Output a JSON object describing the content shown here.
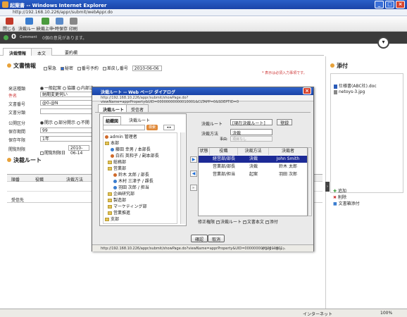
{
  "window": {
    "title": "起案書 -- Windows Internet Explorer",
    "url": "http://192.168.10.226/appr/submit/webAppr.do"
  },
  "toolbar": {
    "items": [
      "閉じる",
      "決裁ルート",
      "決裁上申",
      "一時保存",
      "印刷"
    ]
  },
  "comments": {
    "count": "0",
    "label": "Comment",
    "message": "0個の意見があります。"
  },
  "tabs": [
    "決裁情報",
    "本文",
    "要約欄"
  ],
  "doc": {
    "title": "文書情報",
    "required_note": "* 表示は必須入力事項です。",
    "kind_label": "発送種類",
    "kind_opts": [
      "一般起案",
      "協議",
      "内部決"
    ],
    "badge_opts": [
      "緊急",
      "秘密",
      "番号予約",
      "差戻し番号"
    ],
    "date_value": "2010-06-06",
    "subject_label": "件名",
    "subject_value": "納期変更伺い",
    "docno_label": "文書番号",
    "docno_value": "@0-@N",
    "category_label": "文書分類",
    "public_label": "公開区分",
    "public_opts": [
      "開示",
      "部分開示",
      "不開"
    ],
    "retention_label": "保存期間",
    "retention_value": "99",
    "period_label": "保存年限",
    "period_value": "1年",
    "close_label": "閲覧制限",
    "close_check": "閲覧制限日",
    "close_date": "2010-06-14"
  },
  "route": {
    "title": "決裁ルート",
    "headers": [
      "順番",
      "役職",
      "決裁方法",
      ""
    ],
    "receiver_label": "受信先"
  },
  "attach": {
    "title": "添付",
    "files": [
      "仕様書(ABC社).doc",
      "netoys-3.jpg"
    ],
    "actions": [
      "追加",
      "削除",
      "文書箱添付"
    ]
  },
  "statusbar": {
    "zone": "インターネット",
    "zoom": "100%"
  },
  "modal": {
    "title": "決裁ルート -- Web ページ ダイアログ",
    "url": "http://192.168.10.226/appr/submit/showPage.do?viewName=apprProperty&UID=00000000000010001&CLTAPP=0&SDEPTID=0",
    "tabs": [
      "決裁ルート",
      "受信者"
    ],
    "left_tabs": [
      "組織図",
      "決裁ルート"
    ],
    "search_btn": "検索",
    "tree": [
      {
        "text": "admin 管理者",
        "type": "person"
      },
      {
        "text": "本部",
        "type": "folder"
      },
      {
        "text": "藤田 幸男 / 本部長",
        "type": "person"
      },
      {
        "text": "白石 英和子 / 副本部長",
        "type": "person"
      },
      {
        "text": "総務部",
        "type": "folder"
      },
      {
        "text": "営業部",
        "type": "folder"
      },
      {
        "text": "鈴木 太郎 / 部長",
        "type": "person"
      },
      {
        "text": "木村 三津子 / 課長",
        "type": "person"
      },
      {
        "text": "羽田 次郎 / 担当",
        "type": "person"
      },
      {
        "text": "企画研究部",
        "type": "folder"
      },
      {
        "text": "製造部",
        "type": "folder"
      },
      {
        "text": "マーケティング部",
        "type": "folder"
      },
      {
        "text": "営業推進",
        "type": "folder"
      },
      {
        "text": "支部",
        "type": "folder"
      }
    ],
    "route_label": "決裁ルート",
    "route_value": "[現在決裁ルート]",
    "register_btn": "登録",
    "method_label": "決裁方法",
    "method_value": "決裁",
    "matter_label": "事由:",
    "matter_value": "項目なし",
    "table_headers": [
      "状態",
      "役職",
      "決裁方法",
      "決裁者"
    ],
    "rows": [
      {
        "status": "",
        "role": "経営部/部長",
        "method": "決裁",
        "name": "John Smith",
        "selected": true
      },
      {
        "status": "",
        "role": "営業部/部長",
        "method": "決裁",
        "name": "鈴木 太郎",
        "selected": false
      },
      {
        "status": "",
        "role": "営業部/担当",
        "method": "起案",
        "name": "羽田 次郎",
        "selected": false
      }
    ],
    "perm_label": "修正権限",
    "perm_checks": [
      "決裁ルート",
      "文書本文",
      "添付"
    ],
    "ok_btn": "確認",
    "cancel_btn": "取消",
    "status_url": "http://192.168.10.226/appr/submit/showPage.do?viewName=apprProperty&UID=00000000000010001",
    "status_zone": "インターネット"
  }
}
